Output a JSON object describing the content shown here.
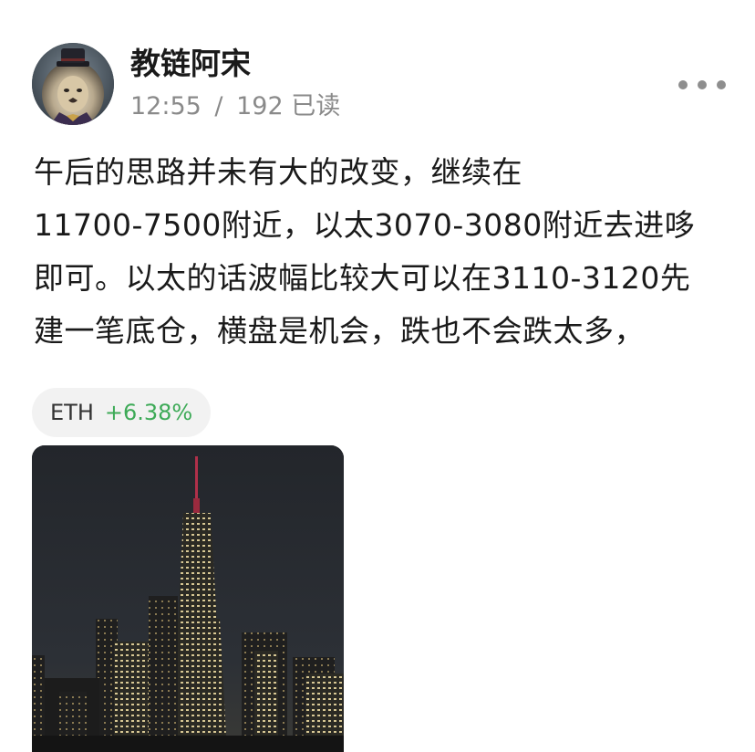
{
  "author": {
    "name": "教链阿宋",
    "avatar_icon": "lion-portrait-avatar"
  },
  "meta": {
    "time": "12:55",
    "separator": "/",
    "read_count": "192",
    "read_label": "已读"
  },
  "post": {
    "lines": [
      "午后的思路并未有大的改变，继续在",
      "11700-7500附近，以太3070-3080附近去进哆",
      "即可。以太的话波幅比较大可以在3110-3120先",
      "建一笔底仓，横盘是机会，跌也不会跌太多，"
    ]
  },
  "ticker": {
    "symbol": "ETH",
    "change": "+6.38%",
    "change_color": "#3daa57"
  },
  "image": {
    "description_icon": "city-night-skyline-photo"
  },
  "colors": {
    "text_primary": "#1a1a1a",
    "text_secondary": "#8a8a8a",
    "chip_bg": "#f2f2f2",
    "positive": "#3daa57"
  }
}
